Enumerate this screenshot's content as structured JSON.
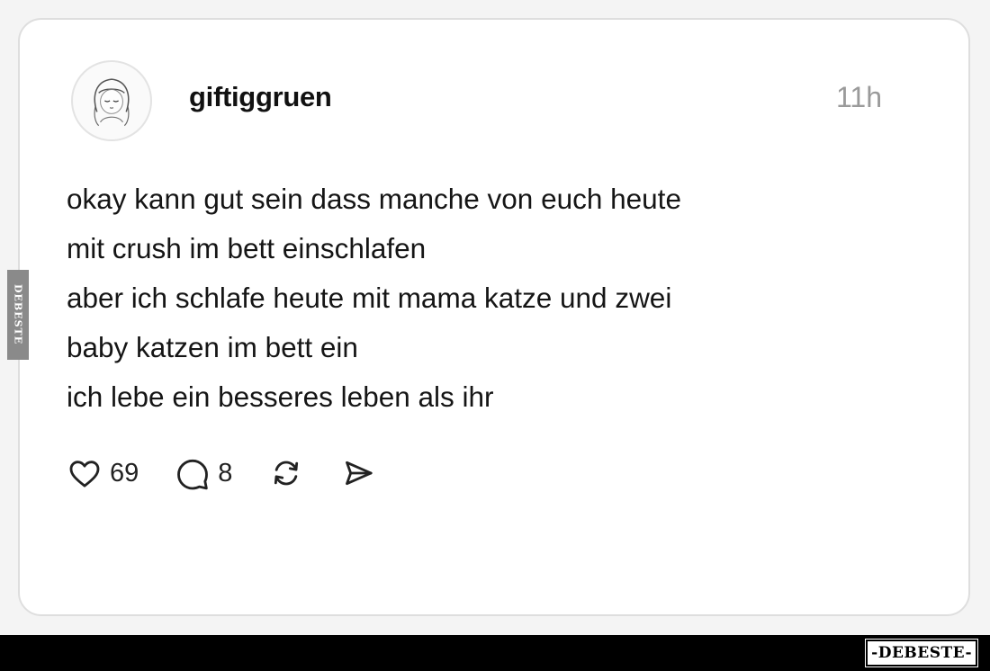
{
  "post": {
    "username": "giftiggruen",
    "timestamp": "11h",
    "lines": [
      "okay kann gut sein dass manche von euch heute",
      "mit crush im bett einschlafen",
      "aber ich schlafe heute mit mama katze und zwei",
      "baby katzen im bett ein",
      "ich lebe ein besseres leben als ihr"
    ],
    "actions": {
      "like_icon": "heart-icon",
      "like_count": "69",
      "comment_icon": "comment-bubble-icon",
      "comment_count": "8",
      "repost_icon": "repost-icon",
      "share_icon": "send-icon"
    }
  },
  "watermark": {
    "side": "DEBESTE",
    "footer": "-DEBESTE-"
  },
  "colors": {
    "background": "#f4f4f4",
    "card": "#ffffff",
    "card_border": "#dedede",
    "text": "#151515",
    "muted": "#9a9a9a",
    "footer_bar": "#000000"
  }
}
